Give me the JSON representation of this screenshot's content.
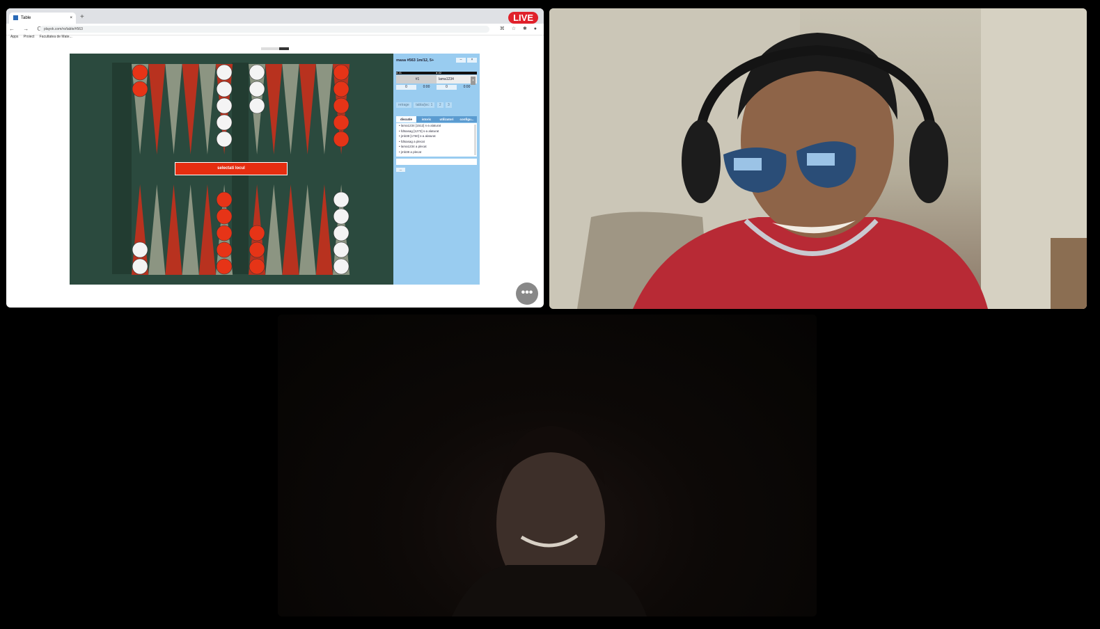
{
  "share": {
    "live_badge": "LIVE",
    "tab_title": "Table",
    "tab_close": "×",
    "new_tab": "+",
    "url": "playok.com/ro/table/#563",
    "nav_icons": "← → C",
    "ext_icons": "⌘ ☆ ✱ ●",
    "bookmarks": [
      "Apps",
      "Proiect",
      "Facultatea de Mate..."
    ],
    "select_location": "selectati locul"
  },
  "panel": {
    "title": "masa #563   1m/12, 5+",
    "win_btns": [
      "–",
      "×"
    ],
    "seat1_label": "● #1",
    "seat2_label": "● #2",
    "seat1_name": "#1",
    "seat2_name": "lama1234",
    "seat2_close": "×",
    "score1": "0",
    "time1": "0:00",
    "score2": "0",
    "time2": "0:00",
    "actions": [
      "retrage",
      "tabla/joc: 1",
      "2",
      "3"
    ],
    "tabs": [
      "discutie",
      "istoric",
      "utilizatori",
      "configu..."
    ],
    "chat": [
      "• lama1234 [1512] s-a alaturat",
      "• fdtsasag [1273] s-a alaturat",
      "• jmb38 [1760] s-a alaturat",
      "• fdtsasag a plecat",
      "• lama1234 a plecat",
      "• jmb38 a plecat"
    ],
    "send": "..."
  },
  "more_label": "•••",
  "colors": {
    "board": "#2b4a3e",
    "red_point": "#b8321f",
    "grey_point": "#8c9582",
    "red_checker": "#e63417",
    "white_checker": "#f4f4f4",
    "panel": "#99ccf0"
  },
  "game": {
    "top_points": [
      {
        "red": 2,
        "white": 0
      },
      {
        "red": 0,
        "white": 0
      },
      {
        "red": 0,
        "white": 0
      },
      {
        "red": 0,
        "white": 0
      },
      {
        "red": 0,
        "white": 0
      },
      {
        "red": 0,
        "white": 5
      },
      {
        "red": 0,
        "white": 3
      },
      {
        "red": 0,
        "white": 0
      },
      {
        "red": 0,
        "white": 0
      },
      {
        "red": 0,
        "white": 0
      },
      {
        "red": 0,
        "white": 0
      },
      {
        "red": 5,
        "white": 0
      }
    ],
    "bottom_points": [
      {
        "red": 0,
        "white": 2
      },
      {
        "red": 0,
        "white": 0
      },
      {
        "red": 0,
        "white": 0
      },
      {
        "red": 0,
        "white": 0
      },
      {
        "red": 0,
        "white": 0
      },
      {
        "red": 5,
        "white": 0
      },
      {
        "red": 3,
        "white": 0
      },
      {
        "red": 0,
        "white": 0
      },
      {
        "red": 0,
        "white": 0
      },
      {
        "red": 0,
        "white": 0
      },
      {
        "red": 0,
        "white": 0
      },
      {
        "red": 0,
        "white": 5
      }
    ]
  }
}
